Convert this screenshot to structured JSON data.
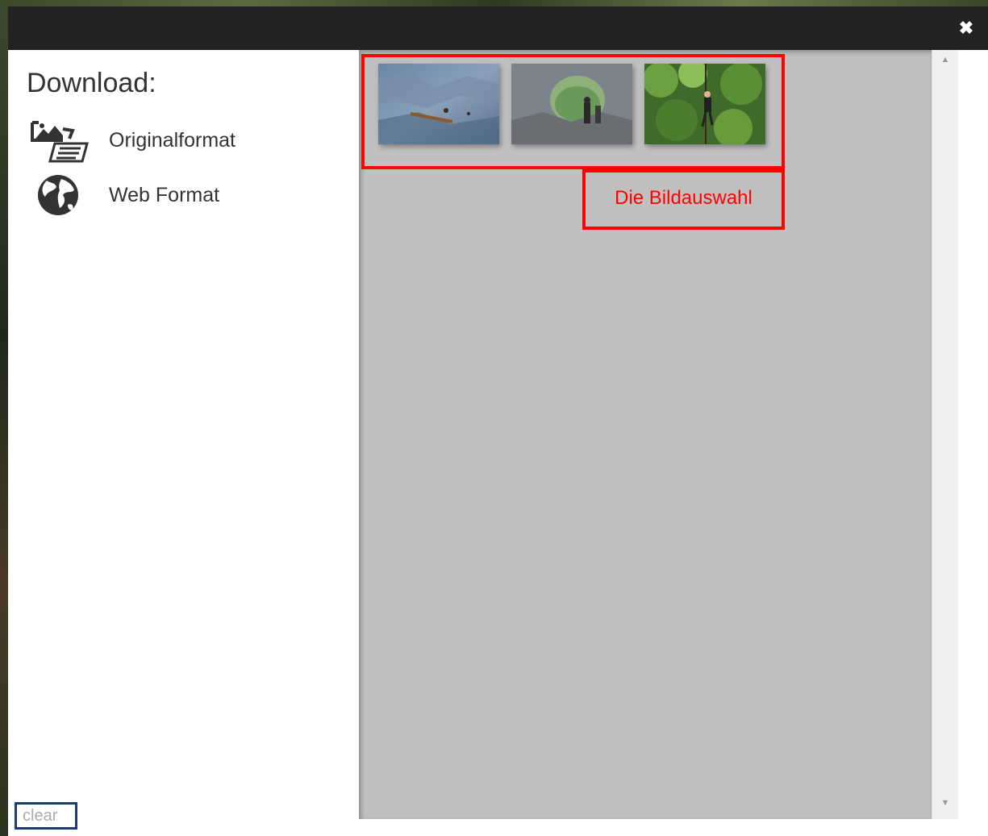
{
  "dialog": {
    "close_icon": "close-icon"
  },
  "download": {
    "title": "Download:",
    "options": [
      {
        "label": "Originalformat",
        "icon": "image-document-icon"
      },
      {
        "label": "Web Format",
        "icon": "globe-icon"
      }
    ]
  },
  "clear_label": "clear",
  "selection": {
    "annotation": "Die Bildauswahl",
    "thumbnails": [
      {
        "name": "thumbnail-rock-face"
      },
      {
        "name": "thumbnail-rock-arch"
      },
      {
        "name": "thumbnail-forest-climber"
      }
    ]
  },
  "colors": {
    "highlight": "#ff0000",
    "titlebar": "#222222",
    "panel": "#c0c0c0"
  }
}
